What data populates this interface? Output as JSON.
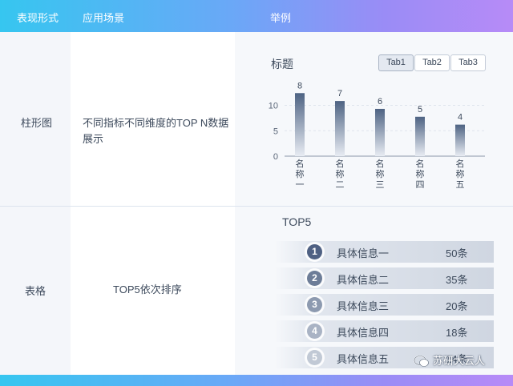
{
  "header": {
    "col1": "表现形式",
    "col2": "应用场景",
    "col3": "举例"
  },
  "rows": [
    {
      "type": "柱形图",
      "scenario": "不同指标不同维度的TOP N数据展示"
    },
    {
      "type": "表格",
      "scenario": "TOP5依次排序"
    }
  ],
  "chart_card": {
    "title": "标题",
    "tabs": [
      {
        "label": "Tab1",
        "active": true
      },
      {
        "label": "Tab2",
        "active": false
      },
      {
        "label": "Tab3",
        "active": false
      }
    ]
  },
  "chart_data": {
    "type": "bar",
    "categories": [
      "名称一",
      "名称二",
      "名称三",
      "名称四",
      "名称五"
    ],
    "category_labels_vertical": [
      [
        "名",
        "称",
        "一"
      ],
      [
        "名",
        "称",
        "二"
      ],
      [
        "名",
        "称",
        "三"
      ],
      [
        "名",
        "称",
        "四"
      ],
      [
        "名",
        "称",
        "五"
      ]
    ],
    "values": [
      8,
      7,
      6,
      5,
      4
    ],
    "yticks": [
      0,
      5,
      10
    ],
    "ylim": [
      0,
      16
    ],
    "grid": true,
    "bar_gradient": [
      "#4e6383",
      "#e8ecf3"
    ]
  },
  "top5": {
    "title": "TOP5",
    "items": [
      {
        "rank": "1",
        "name": "具体信息一",
        "value": "50条",
        "color": "#4f6183"
      },
      {
        "rank": "2",
        "name": "具体信息二",
        "value": "35条",
        "color": "#6d7d98"
      },
      {
        "rank": "3",
        "name": "具体信息三",
        "value": "20条",
        "color": "#8d9ab0"
      },
      {
        "rank": "4",
        "name": "具体信息四",
        "value": "18条",
        "color": "#a9b3c4"
      },
      {
        "rank": "5",
        "name": "具体信息五",
        "value": "14条",
        "color": "#c1c9d5"
      }
    ]
  },
  "watermark": "苏研大云人"
}
